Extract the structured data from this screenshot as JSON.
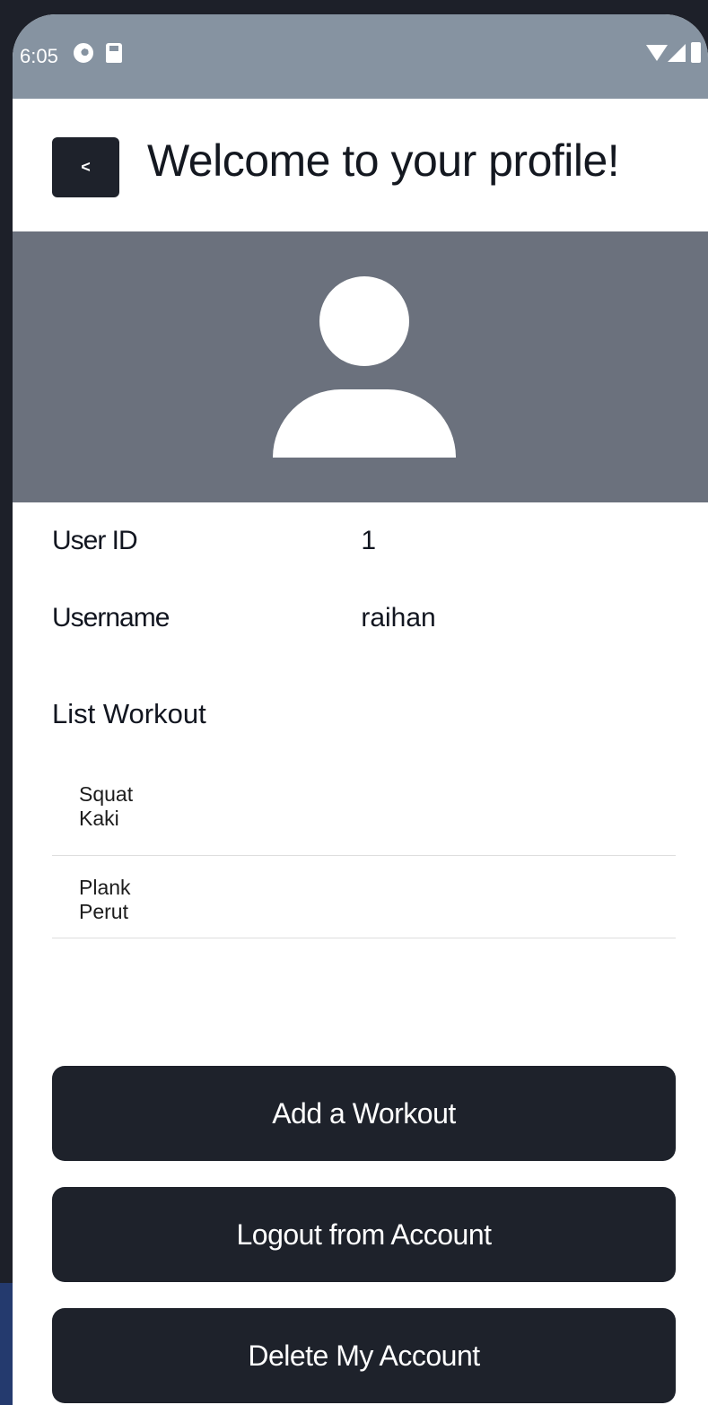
{
  "status_bar": {
    "time": "6:05"
  },
  "header": {
    "back_label": "<",
    "title": "Welcome to your profile!"
  },
  "profile": {
    "user_id_label": "User ID",
    "user_id_value": "1",
    "username_label": "Username",
    "username_value": "raihan"
  },
  "workouts": {
    "title": "List Workout",
    "items": [
      {
        "name": "Squat",
        "category": "Kaki"
      },
      {
        "name": "Plank",
        "category": "Perut"
      }
    ]
  },
  "actions": {
    "add_workout": "Add a Workout",
    "logout": "Logout from Account",
    "delete_account": "Delete My Account"
  },
  "colors": {
    "status_bar": "#8693a1",
    "banner": "#6b717d",
    "button": "#1e222b"
  },
  "icons": [
    "notification-icon",
    "sd-card-icon",
    "wifi-icon",
    "signal-icon",
    "battery-icon",
    "avatar-icon"
  ]
}
